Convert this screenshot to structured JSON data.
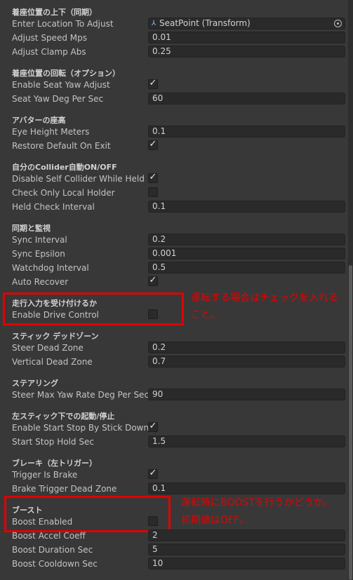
{
  "sections": {
    "seat_position": "着座位置の上下（同期）",
    "seat_rotation": "着座位置の回転（オプション）",
    "avatar_height": "アバターの座高",
    "collider": "自分のCollider自動ON/OFF",
    "sync": "同期と監視",
    "drive_input": "走行入力を受け付けるか",
    "stick_deadzone": "スティック デッドゾーン",
    "steering": "ステアリング",
    "stick_start_stop": "左スティック下での起動/停止",
    "brake": "ブレーキ（左トリガー）",
    "boost": "ブースト"
  },
  "fields": {
    "enter_location": {
      "label": "Enter Location To Adjust",
      "value": "SeatPoint (Transform)",
      "icon": "transform-icon"
    },
    "adjust_speed": {
      "label": "Adjust Speed Mps",
      "value": "0.01"
    },
    "adjust_clamp": {
      "label": "Adjust Clamp Abs",
      "value": "0.25"
    },
    "enable_seat_yaw": {
      "label": "Enable Seat Yaw Adjust",
      "checked": true
    },
    "seat_yaw_deg": {
      "label": "Seat Yaw Deg Per Sec",
      "value": "60"
    },
    "eye_height": {
      "label": "Eye Height Meters",
      "value": "0.1"
    },
    "restore_default": {
      "label": "Restore Default On Exit",
      "checked": true
    },
    "disable_self_collider": {
      "label": "Disable Self Collider While Held",
      "checked": true
    },
    "check_only_local": {
      "label": "Check Only Local Holder",
      "checked": false
    },
    "held_check_interval": {
      "label": "Held Check Interval",
      "value": "0.1"
    },
    "sync_interval": {
      "label": "Sync Interval",
      "value": "0.2"
    },
    "sync_epsilon": {
      "label": "Sync Epsilon",
      "value": "0.001"
    },
    "watchdog_interval": {
      "label": "Watchdog Interval",
      "value": "0.5"
    },
    "auto_recover": {
      "label": "Auto Recover",
      "checked": true
    },
    "enable_drive": {
      "label": "Enable Drive Control",
      "checked": false
    },
    "steer_dead_zone": {
      "label": "Steer Dead Zone",
      "value": "0.2"
    },
    "vertical_dead_zone": {
      "label": "Vertical Dead Zone",
      "value": "0.7"
    },
    "steer_max_yaw": {
      "label": "Steer Max Yaw Rate Deg Per Sec",
      "value": "90"
    },
    "enable_start_stop": {
      "label": "Enable Start Stop By Stick Down",
      "checked": true
    },
    "start_stop_hold": {
      "label": "Start Stop Hold Sec",
      "value": "1.5"
    },
    "trigger_is_brake": {
      "label": "Trigger Is Brake",
      "checked": true
    },
    "brake_dead_zone": {
      "label": "Brake Trigger Dead Zone",
      "value": "0.1"
    },
    "boost_enabled": {
      "label": "Boost Enabled",
      "checked": false
    },
    "boost_accel": {
      "label": "Boost Accel Coeff",
      "value": "2"
    },
    "boost_duration": {
      "label": "Boost Duration Sec",
      "value": "5"
    },
    "boost_cooldown": {
      "label": "Boost Cooldown Sec",
      "value": "10"
    }
  },
  "annotations": {
    "drive_line1": "運転する場合はチェックを入れる",
    "drive_line2": "こと。",
    "boost_line1": "運転時にBOOSTを行うかどうか。",
    "boost_line2": "初期値はOFF。"
  },
  "colors": {
    "background": "#383838",
    "field_bg": "#2a2a2a",
    "highlight_red": "#e10000"
  }
}
